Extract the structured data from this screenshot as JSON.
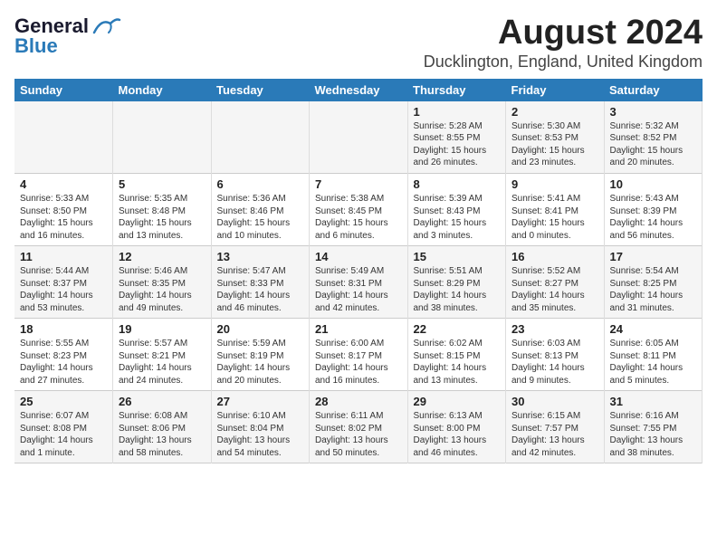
{
  "header": {
    "logo_line1": "General",
    "logo_line2": "Blue",
    "month_year": "August 2024",
    "location": "Ducklington, England, United Kingdom"
  },
  "days_of_week": [
    "Sunday",
    "Monday",
    "Tuesday",
    "Wednesday",
    "Thursday",
    "Friday",
    "Saturday"
  ],
  "weeks": [
    [
      {
        "day": "",
        "content": ""
      },
      {
        "day": "",
        "content": ""
      },
      {
        "day": "",
        "content": ""
      },
      {
        "day": "",
        "content": ""
      },
      {
        "day": "1",
        "content": "Sunrise: 5:28 AM\nSunset: 8:55 PM\nDaylight: 15 hours\nand 26 minutes."
      },
      {
        "day": "2",
        "content": "Sunrise: 5:30 AM\nSunset: 8:53 PM\nDaylight: 15 hours\nand 23 minutes."
      },
      {
        "day": "3",
        "content": "Sunrise: 5:32 AM\nSunset: 8:52 PM\nDaylight: 15 hours\nand 20 minutes."
      }
    ],
    [
      {
        "day": "4",
        "content": "Sunrise: 5:33 AM\nSunset: 8:50 PM\nDaylight: 15 hours\nand 16 minutes."
      },
      {
        "day": "5",
        "content": "Sunrise: 5:35 AM\nSunset: 8:48 PM\nDaylight: 15 hours\nand 13 minutes."
      },
      {
        "day": "6",
        "content": "Sunrise: 5:36 AM\nSunset: 8:46 PM\nDaylight: 15 hours\nand 10 minutes."
      },
      {
        "day": "7",
        "content": "Sunrise: 5:38 AM\nSunset: 8:45 PM\nDaylight: 15 hours\nand 6 minutes."
      },
      {
        "day": "8",
        "content": "Sunrise: 5:39 AM\nSunset: 8:43 PM\nDaylight: 15 hours\nand 3 minutes."
      },
      {
        "day": "9",
        "content": "Sunrise: 5:41 AM\nSunset: 8:41 PM\nDaylight: 15 hours\nand 0 minutes."
      },
      {
        "day": "10",
        "content": "Sunrise: 5:43 AM\nSunset: 8:39 PM\nDaylight: 14 hours\nand 56 minutes."
      }
    ],
    [
      {
        "day": "11",
        "content": "Sunrise: 5:44 AM\nSunset: 8:37 PM\nDaylight: 14 hours\nand 53 minutes."
      },
      {
        "day": "12",
        "content": "Sunrise: 5:46 AM\nSunset: 8:35 PM\nDaylight: 14 hours\nand 49 minutes."
      },
      {
        "day": "13",
        "content": "Sunrise: 5:47 AM\nSunset: 8:33 PM\nDaylight: 14 hours\nand 46 minutes."
      },
      {
        "day": "14",
        "content": "Sunrise: 5:49 AM\nSunset: 8:31 PM\nDaylight: 14 hours\nand 42 minutes."
      },
      {
        "day": "15",
        "content": "Sunrise: 5:51 AM\nSunset: 8:29 PM\nDaylight: 14 hours\nand 38 minutes."
      },
      {
        "day": "16",
        "content": "Sunrise: 5:52 AM\nSunset: 8:27 PM\nDaylight: 14 hours\nand 35 minutes."
      },
      {
        "day": "17",
        "content": "Sunrise: 5:54 AM\nSunset: 8:25 PM\nDaylight: 14 hours\nand 31 minutes."
      }
    ],
    [
      {
        "day": "18",
        "content": "Sunrise: 5:55 AM\nSunset: 8:23 PM\nDaylight: 14 hours\nand 27 minutes."
      },
      {
        "day": "19",
        "content": "Sunrise: 5:57 AM\nSunset: 8:21 PM\nDaylight: 14 hours\nand 24 minutes."
      },
      {
        "day": "20",
        "content": "Sunrise: 5:59 AM\nSunset: 8:19 PM\nDaylight: 14 hours\nand 20 minutes."
      },
      {
        "day": "21",
        "content": "Sunrise: 6:00 AM\nSunset: 8:17 PM\nDaylight: 14 hours\nand 16 minutes."
      },
      {
        "day": "22",
        "content": "Sunrise: 6:02 AM\nSunset: 8:15 PM\nDaylight: 14 hours\nand 13 minutes."
      },
      {
        "day": "23",
        "content": "Sunrise: 6:03 AM\nSunset: 8:13 PM\nDaylight: 14 hours\nand 9 minutes."
      },
      {
        "day": "24",
        "content": "Sunrise: 6:05 AM\nSunset: 8:11 PM\nDaylight: 14 hours\nand 5 minutes."
      }
    ],
    [
      {
        "day": "25",
        "content": "Sunrise: 6:07 AM\nSunset: 8:08 PM\nDaylight: 14 hours\nand 1 minute."
      },
      {
        "day": "26",
        "content": "Sunrise: 6:08 AM\nSunset: 8:06 PM\nDaylight: 13 hours\nand 58 minutes."
      },
      {
        "day": "27",
        "content": "Sunrise: 6:10 AM\nSunset: 8:04 PM\nDaylight: 13 hours\nand 54 minutes."
      },
      {
        "day": "28",
        "content": "Sunrise: 6:11 AM\nSunset: 8:02 PM\nDaylight: 13 hours\nand 50 minutes."
      },
      {
        "day": "29",
        "content": "Sunrise: 6:13 AM\nSunset: 8:00 PM\nDaylight: 13 hours\nand 46 minutes."
      },
      {
        "day": "30",
        "content": "Sunrise: 6:15 AM\nSunset: 7:57 PM\nDaylight: 13 hours\nand 42 minutes."
      },
      {
        "day": "31",
        "content": "Sunrise: 6:16 AM\nSunset: 7:55 PM\nDaylight: 13 hours\nand 38 minutes."
      }
    ]
  ]
}
